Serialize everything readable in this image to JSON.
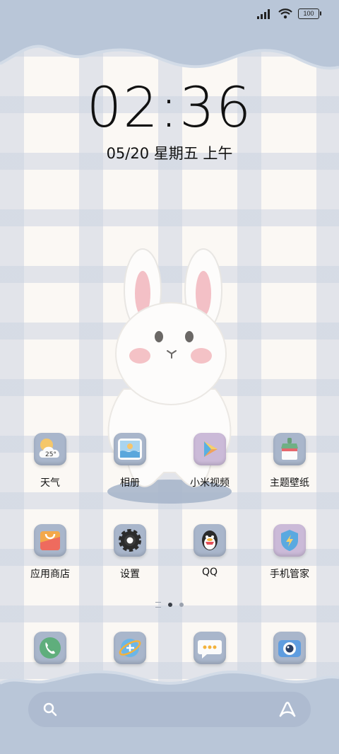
{
  "status_bar": {
    "battery": "100",
    "signal_icon": "signal-icon",
    "wifi_icon": "wifi-icon"
  },
  "clock": {
    "time": "02:36",
    "date": "05/20 星期五 上午"
  },
  "apps_row1": [
    {
      "label": "天气",
      "icon": "weather-icon",
      "temp": "25°"
    },
    {
      "label": "相册",
      "icon": "gallery-icon"
    },
    {
      "label": "小米视频",
      "icon": "video-icon"
    },
    {
      "label": "主题壁纸",
      "icon": "themes-icon"
    }
  ],
  "apps_row2": [
    {
      "label": "应用商店",
      "icon": "app-store-icon"
    },
    {
      "label": "设置",
      "icon": "settings-icon"
    },
    {
      "label": "QQ",
      "icon": "qq-icon"
    },
    {
      "label": "手机管家",
      "icon": "security-icon"
    }
  ],
  "dock": [
    {
      "icon": "phone-icon"
    },
    {
      "icon": "browser-icon"
    },
    {
      "icon": "messages-icon"
    },
    {
      "icon": "camera-icon"
    }
  ],
  "page_indicator": {
    "pages": 2,
    "current": 1
  },
  "search_bar": {
    "icon": "search-icon",
    "assistant_icon": "assistant-icon"
  },
  "colors": {
    "cloud": "#b9c6d8",
    "plaid": "#cdd4e1",
    "background": "#fbf8f4"
  }
}
